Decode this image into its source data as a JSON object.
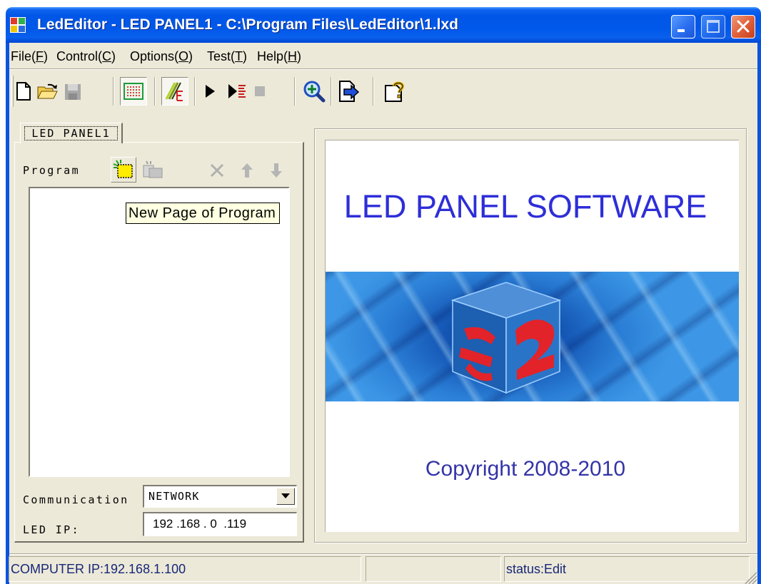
{
  "window": {
    "title": "LedEditor - LED PANEL1 - C:\\Program Files\\LedEditor\\1.lxd",
    "app_icon": "led-editor-app-icon",
    "controls": [
      "minimize-icon",
      "maximize-icon",
      "close-icon"
    ]
  },
  "menu": {
    "items": [
      {
        "pre": "File(",
        "key": "F",
        "post": ")"
      },
      {
        "pre": "Control(",
        "key": "C",
        "post": ")"
      },
      {
        "pre": "Options(",
        "key": "O",
        "post": ")"
      },
      {
        "pre": "Test(",
        "key": "T",
        "post": ")"
      },
      {
        "pre": "Help(",
        "key": "H",
        "post": ")"
      }
    ]
  },
  "toolbar": {
    "buttons": [
      {
        "icon": "new-document-icon",
        "enabled": true,
        "pressed": false
      },
      {
        "icon": "open-folder-icon",
        "enabled": true,
        "pressed": false
      },
      {
        "icon": "save-icon",
        "enabled": false,
        "pressed": false
      },
      {
        "icon": "grid-view-icon",
        "enabled": true,
        "pressed": true
      },
      {
        "icon": "edit-mode-icon",
        "enabled": true,
        "pressed": true
      },
      {
        "icon": "play-icon",
        "enabled": true,
        "pressed": false
      },
      {
        "icon": "step-play-icon",
        "enabled": true,
        "pressed": false
      },
      {
        "icon": "stop-icon",
        "enabled": false,
        "pressed": false
      },
      {
        "icon": "zoom-in-icon",
        "enabled": true,
        "pressed": false
      },
      {
        "icon": "export-icon",
        "enabled": true,
        "pressed": false
      },
      {
        "icon": "help-icon",
        "enabled": true,
        "pressed": false
      }
    ]
  },
  "program_panel": {
    "tab_label": "LED PANEL1",
    "program_label": "Program",
    "tools": [
      {
        "icon": "new-page-icon",
        "enabled": true
      },
      {
        "icon": "page-properties-icon",
        "enabled": false
      },
      {
        "icon": "delete-icon",
        "enabled": false
      },
      {
        "icon": "move-up-icon",
        "enabled": false
      },
      {
        "icon": "move-down-icon",
        "enabled": false
      }
    ],
    "tooltip": "New Page of Program",
    "program_items": [],
    "communication_label": "Communication",
    "communication_value": "NETWORK",
    "led_ip_label": "LED IP:",
    "led_ip_value": "192 .168 . 0  .119"
  },
  "preview": {
    "heading": "LED PANEL SOFTWARE",
    "copyright": "Copyright 2008-2010",
    "banner_logo": "cube-logo"
  },
  "status_bar": {
    "computer_ip": "COMPUTER IP:192.168.1.100",
    "status": "status:Edit"
  },
  "colors": {
    "title_bar": "#0056e6",
    "window_bg": "#ece9d8",
    "heading_blue": "#2e2ed8",
    "copyright_blue": "#3434a8",
    "tooltip_bg": "#ffffe1",
    "close_button": "#e0623c"
  }
}
